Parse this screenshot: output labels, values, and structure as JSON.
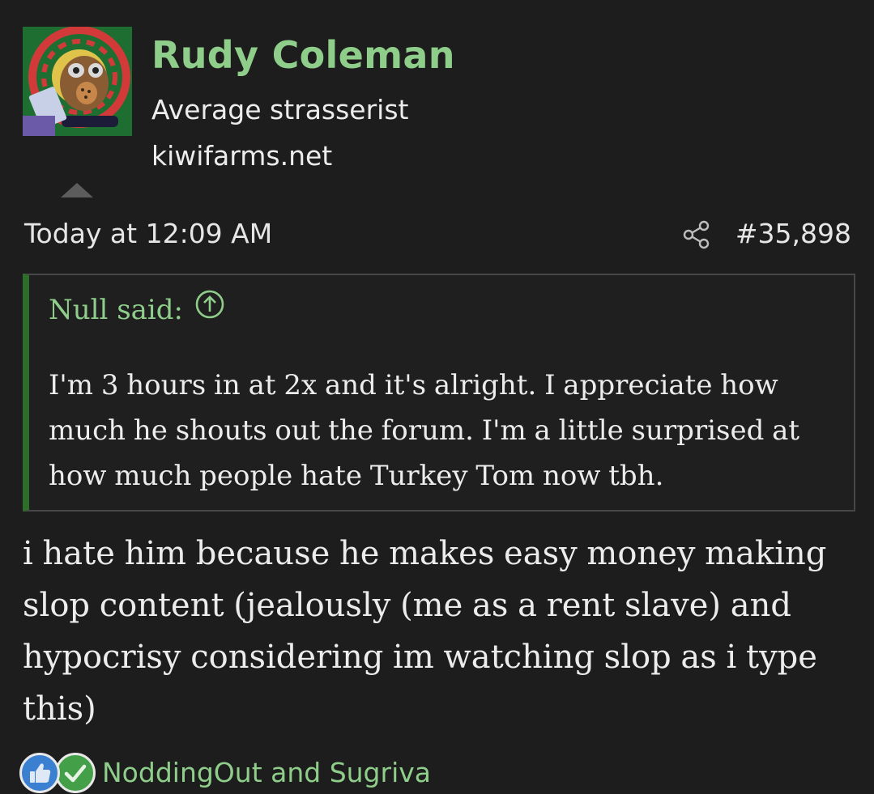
{
  "user": {
    "name": "Rudy Coleman",
    "title": "Average strasserist",
    "site": "kiwifarms.net"
  },
  "post": {
    "date": "Today at 12:09 AM",
    "number": "#35,898",
    "quote": {
      "author_label": "Null said:",
      "lines": [
        "I'm 3 hours in at 2x and it's alright. I appreciate how",
        "much he shouts out the forum. I'm a little surprised at",
        "how much people hate Turkey Tom now tbh."
      ]
    },
    "body_lines": [
      "i hate him because he makes easy money making",
      "slop content (jealously (me as a rent slave) and",
      "hypocrisy considering im watching slop as i type",
      "this)"
    ]
  },
  "reactions": {
    "users_text": "NoddingOut and Sugriva",
    "icons": [
      "like-reaction-icon",
      "agree-reaction-icon"
    ]
  },
  "colors": {
    "background": "#1d1d1d",
    "accent_green": "#8fce8a",
    "quote_border": "#2f6d2c",
    "text": "#ececec"
  }
}
